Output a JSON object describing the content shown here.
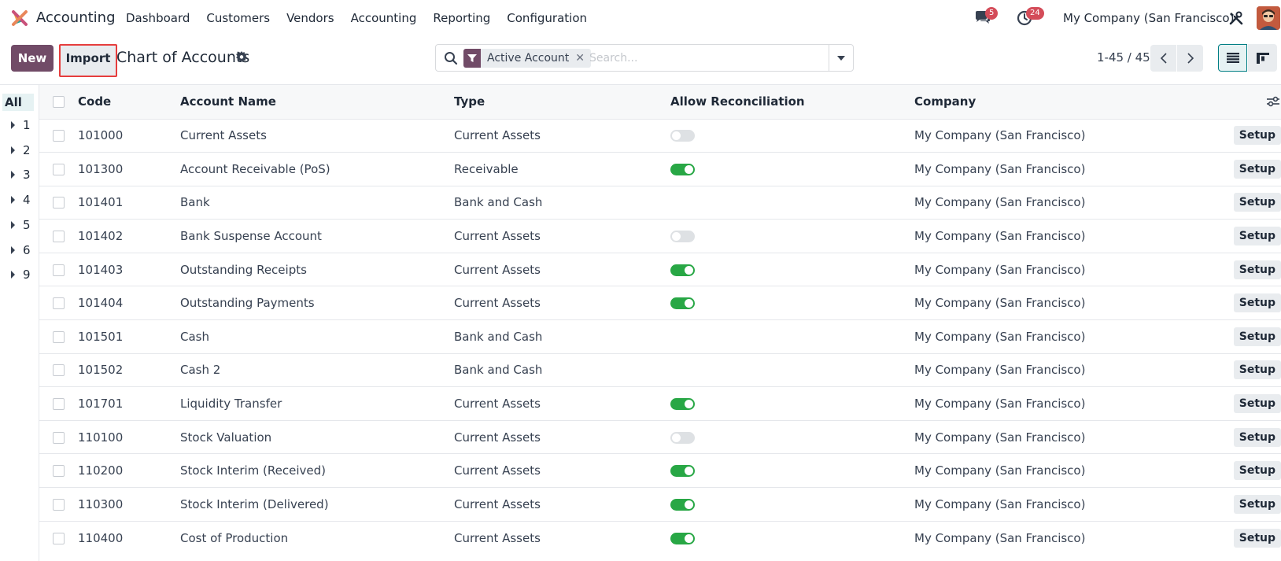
{
  "app": {
    "name": "Accounting",
    "menu": [
      "Dashboard",
      "Customers",
      "Vendors",
      "Accounting",
      "Reporting",
      "Configuration"
    ],
    "chat_count": "5",
    "activity_count": "24",
    "company": "My Company (San Francisco)"
  },
  "control": {
    "new_label": "New",
    "import_label": "Import",
    "title": "Chart of Accounts",
    "facet_label": "Active Account",
    "search_placeholder": "Search...",
    "pager": "1-45 / 45"
  },
  "side_panel": {
    "all_label": "All",
    "groups": [
      "1",
      "2",
      "3",
      "4",
      "5",
      "6",
      "9"
    ]
  },
  "table": {
    "headers": {
      "code": "Code",
      "name": "Account Name",
      "type": "Type",
      "reconcile": "Allow Reconciliation",
      "company": "Company"
    },
    "setup_label": "Setup",
    "rows": [
      {
        "code": "101000",
        "name": "Current Assets",
        "type": "Current Assets",
        "reconcile": "off",
        "company": "My Company (San Francisco)"
      },
      {
        "code": "101300",
        "name": "Account Receivable (PoS)",
        "type": "Receivable",
        "reconcile": "on",
        "company": "My Company (San Francisco)"
      },
      {
        "code": "101401",
        "name": "Bank",
        "type": "Bank and Cash",
        "reconcile": "none",
        "company": "My Company (San Francisco)"
      },
      {
        "code": "101402",
        "name": "Bank Suspense Account",
        "type": "Current Assets",
        "reconcile": "off",
        "company": "My Company (San Francisco)"
      },
      {
        "code": "101403",
        "name": "Outstanding Receipts",
        "type": "Current Assets",
        "reconcile": "on",
        "company": "My Company (San Francisco)"
      },
      {
        "code": "101404",
        "name": "Outstanding Payments",
        "type": "Current Assets",
        "reconcile": "on",
        "company": "My Company (San Francisco)"
      },
      {
        "code": "101501",
        "name": "Cash",
        "type": "Bank and Cash",
        "reconcile": "none",
        "company": "My Company (San Francisco)"
      },
      {
        "code": "101502",
        "name": "Cash 2",
        "type": "Bank and Cash",
        "reconcile": "none",
        "company": "My Company (San Francisco)"
      },
      {
        "code": "101701",
        "name": "Liquidity Transfer",
        "type": "Current Assets",
        "reconcile": "on",
        "company": "My Company (San Francisco)"
      },
      {
        "code": "110100",
        "name": "Stock Valuation",
        "type": "Current Assets",
        "reconcile": "off",
        "company": "My Company (San Francisco)"
      },
      {
        "code": "110200",
        "name": "Stock Interim (Received)",
        "type": "Current Assets",
        "reconcile": "on",
        "company": "My Company (San Francisco)"
      },
      {
        "code": "110300",
        "name": "Stock Interim (Delivered)",
        "type": "Current Assets",
        "reconcile": "on",
        "company": "My Company (San Francisco)"
      },
      {
        "code": "110400",
        "name": "Cost of Production",
        "type": "Current Assets",
        "reconcile": "on",
        "company": "My Company (San Francisco)"
      }
    ]
  },
  "colors": {
    "brand": "#714b67",
    "accent": "#017e84",
    "toggle_on": "#28a745",
    "badge": "#d44c59",
    "highlight": "#e63d3d"
  }
}
